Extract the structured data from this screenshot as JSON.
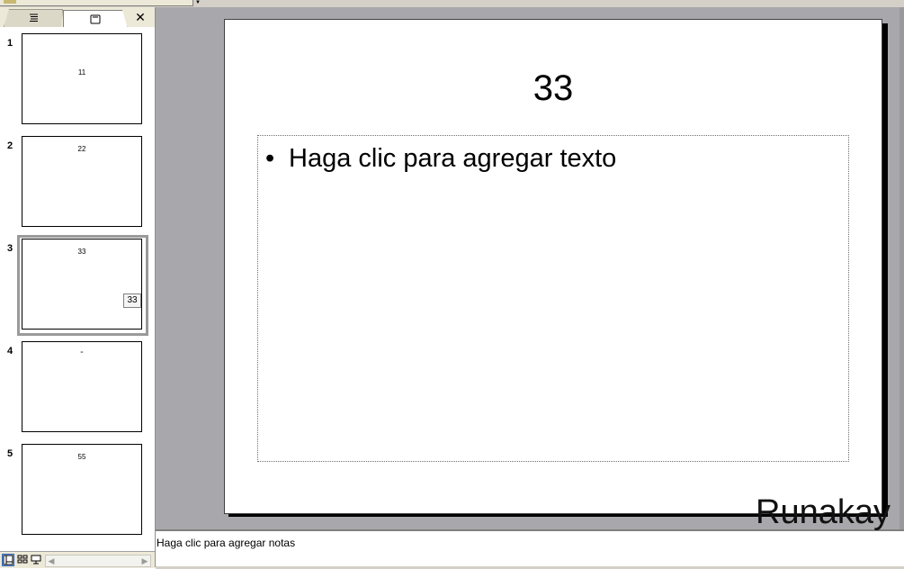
{
  "left_pane": {
    "tabs": [
      {
        "name": "outline",
        "icon": "outline-icon"
      },
      {
        "name": "slides",
        "icon": "slides-icon"
      }
    ],
    "close_label": "✕",
    "slides": [
      {
        "number": "1",
        "title": "11"
      },
      {
        "number": "2",
        "title": "22"
      },
      {
        "number": "3",
        "title": "33",
        "selected": true,
        "badge": "33"
      },
      {
        "number": "4",
        "title": "‘‘"
      },
      {
        "number": "5",
        "title": "55"
      }
    ],
    "view_buttons": [
      "normal-view-icon",
      "slide-sorter-icon",
      "slide-show-icon"
    ]
  },
  "slide": {
    "title": "33",
    "bullet_marker": "•",
    "bullet_text": "Haga clic para agregar texto"
  },
  "notes": {
    "placeholder": "Haga clic para agregar notas"
  },
  "watermark": "Runakay",
  "colors": {
    "workspace_bg": "#a8a8ac",
    "chrome": "#ece9d8",
    "selection_frame": "#9a9a9a"
  }
}
